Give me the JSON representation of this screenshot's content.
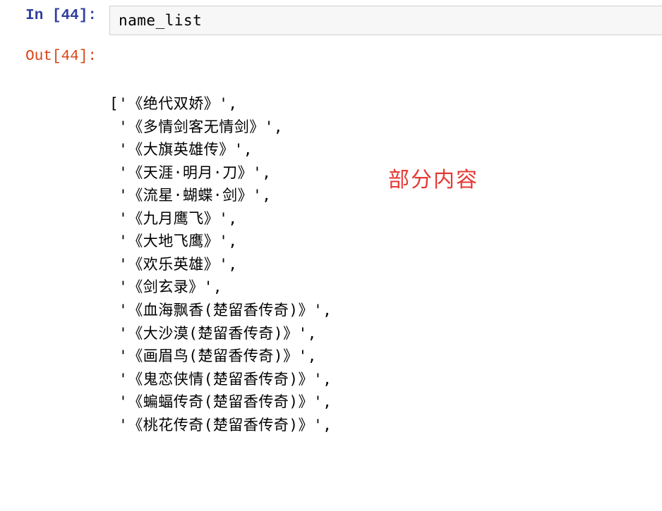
{
  "input_cell": {
    "prompt": "In [44]:",
    "code": "name_list"
  },
  "output_cell": {
    "prompt": "Out[44]:",
    "list_open": "[",
    "items": [
      "'《绝代双娇》'",
      "'《多情剑客无情剑》'",
      "'《大旗英雄传》'",
      "'《天涯·明月·刀》'",
      "'《流星·蝴蝶·剑》'",
      "'《九月鹰飞》'",
      "'《大地飞鹰》'",
      "'《欢乐英雄》'",
      "'《剑玄录》'",
      "'《血海飘香(楚留香传奇)》'",
      "'《大沙漠(楚留香传奇)》'",
      "'《画眉鸟(楚留香传奇)》'",
      "'《鬼恋侠情(楚留香传奇)》'",
      "'《蝙蝠传奇(楚留香传奇)》'",
      "'《桃花传奇(楚留香传奇)》'"
    ]
  },
  "annotation": {
    "text": "部分内容"
  }
}
